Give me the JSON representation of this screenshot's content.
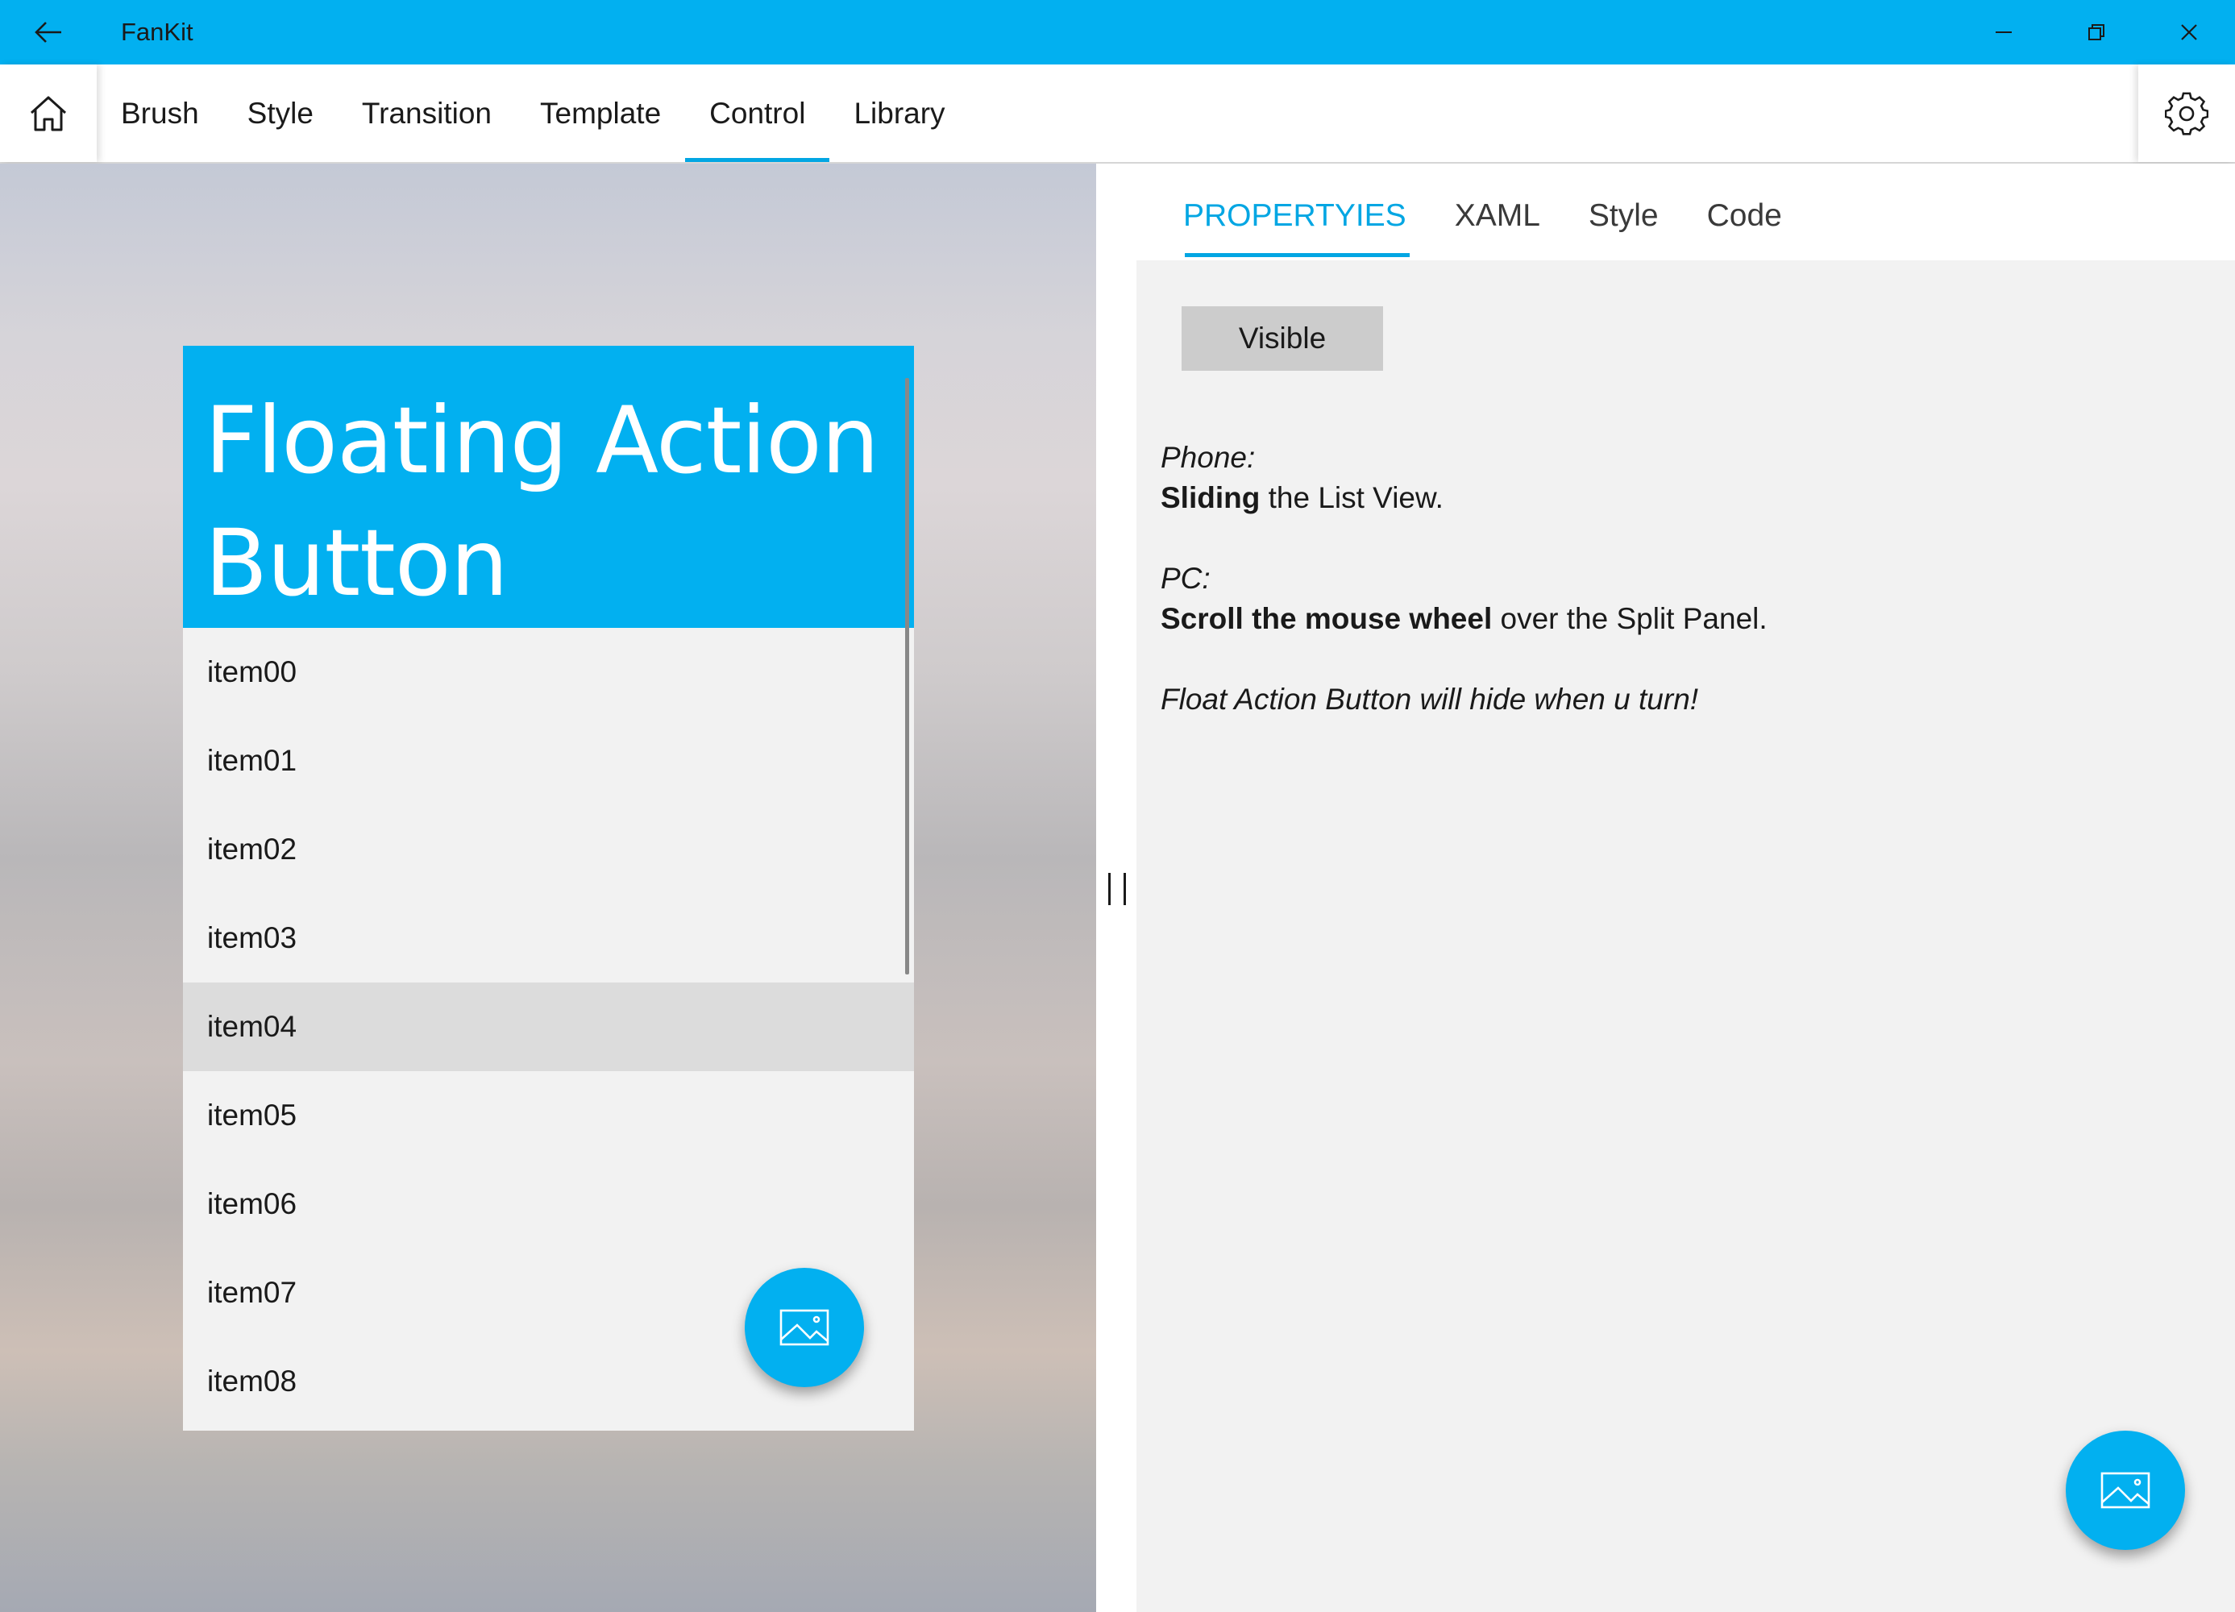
{
  "window": {
    "title": "FanKit",
    "accent_color": "#02b0f0"
  },
  "nav": {
    "tabs": [
      {
        "label": "Brush"
      },
      {
        "label": "Style"
      },
      {
        "label": "Transition"
      },
      {
        "label": "Template"
      },
      {
        "label": "Control",
        "active": true
      },
      {
        "label": "Library"
      }
    ]
  },
  "demo": {
    "header_line1": "Floating Action",
    "header_line2": "Button",
    "items": [
      "item00",
      "item01",
      "item02",
      "item03",
      "item04",
      "item05",
      "item06",
      "item07",
      "item08"
    ],
    "selected_item": "item04",
    "fab_icon": "image-icon"
  },
  "panel": {
    "tabs": [
      {
        "label": "PROPERTYIES",
        "active": true
      },
      {
        "label": "XAML"
      },
      {
        "label": "Style"
      },
      {
        "label": "Code"
      }
    ],
    "visible_button": "Visible",
    "phone_label": "Phone:",
    "phone_bold": "Sliding",
    "phone_rest": " the List View.",
    "pc_label": "PC:",
    "pc_bold": "Scroll the mouse wheel",
    "pc_rest": " over the Split Panel.",
    "note": "Float Action Button will hide when u turn!"
  }
}
